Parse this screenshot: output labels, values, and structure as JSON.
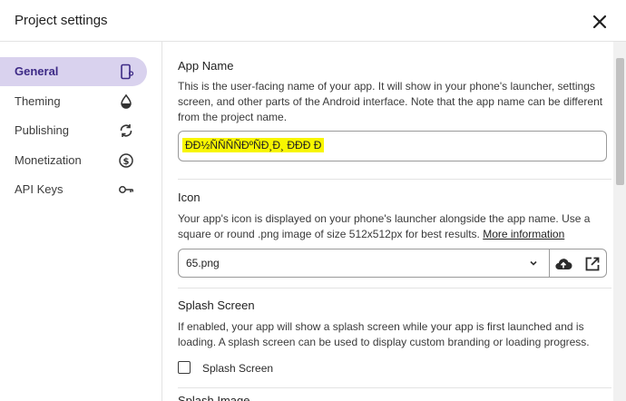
{
  "header": {
    "title": "Project settings",
    "close_icon": "close-icon"
  },
  "sidebar": {
    "items": [
      {
        "label": "General",
        "icon": "phone-settings-icon",
        "active": true
      },
      {
        "label": "Theming",
        "icon": "water-drop-icon",
        "active": false
      },
      {
        "label": "Publishing",
        "icon": "sync-icon",
        "active": false
      },
      {
        "label": "Monetization",
        "icon": "dollar-circle-icon",
        "active": false
      },
      {
        "label": "API Keys",
        "icon": "key-icon",
        "active": false
      }
    ]
  },
  "app_name": {
    "title": "App Name",
    "description": "This is the user-facing name of your app. It will show in your phone's launcher, settings screen, and other parts of the Android interface. Note that the app name can be different from the project name.",
    "value": "ÐÐ½ÑÑÑÑÐºÑÐ¸Ð¸ ÐÐÐ Ð"
  },
  "icon": {
    "title": "Icon",
    "description": "Your app's icon is displayed on your phone's launcher alongside the app name. Use a square or round .png image of size 512x512px for best results.",
    "link": "More information",
    "selected": "65.png"
  },
  "splash": {
    "title": "Splash Screen",
    "description": "If enabled, your app will show a splash screen while your app is first launched and is loading. A splash screen can be used to display custom branding or loading progress.",
    "checkbox_label": "Splash Screen",
    "checked": false
  },
  "next_section_partial": "Splash Image",
  "colors": {
    "accent": "#3d2a86",
    "active_bg": "#d9d2ee",
    "highlight": "#f8f600"
  }
}
